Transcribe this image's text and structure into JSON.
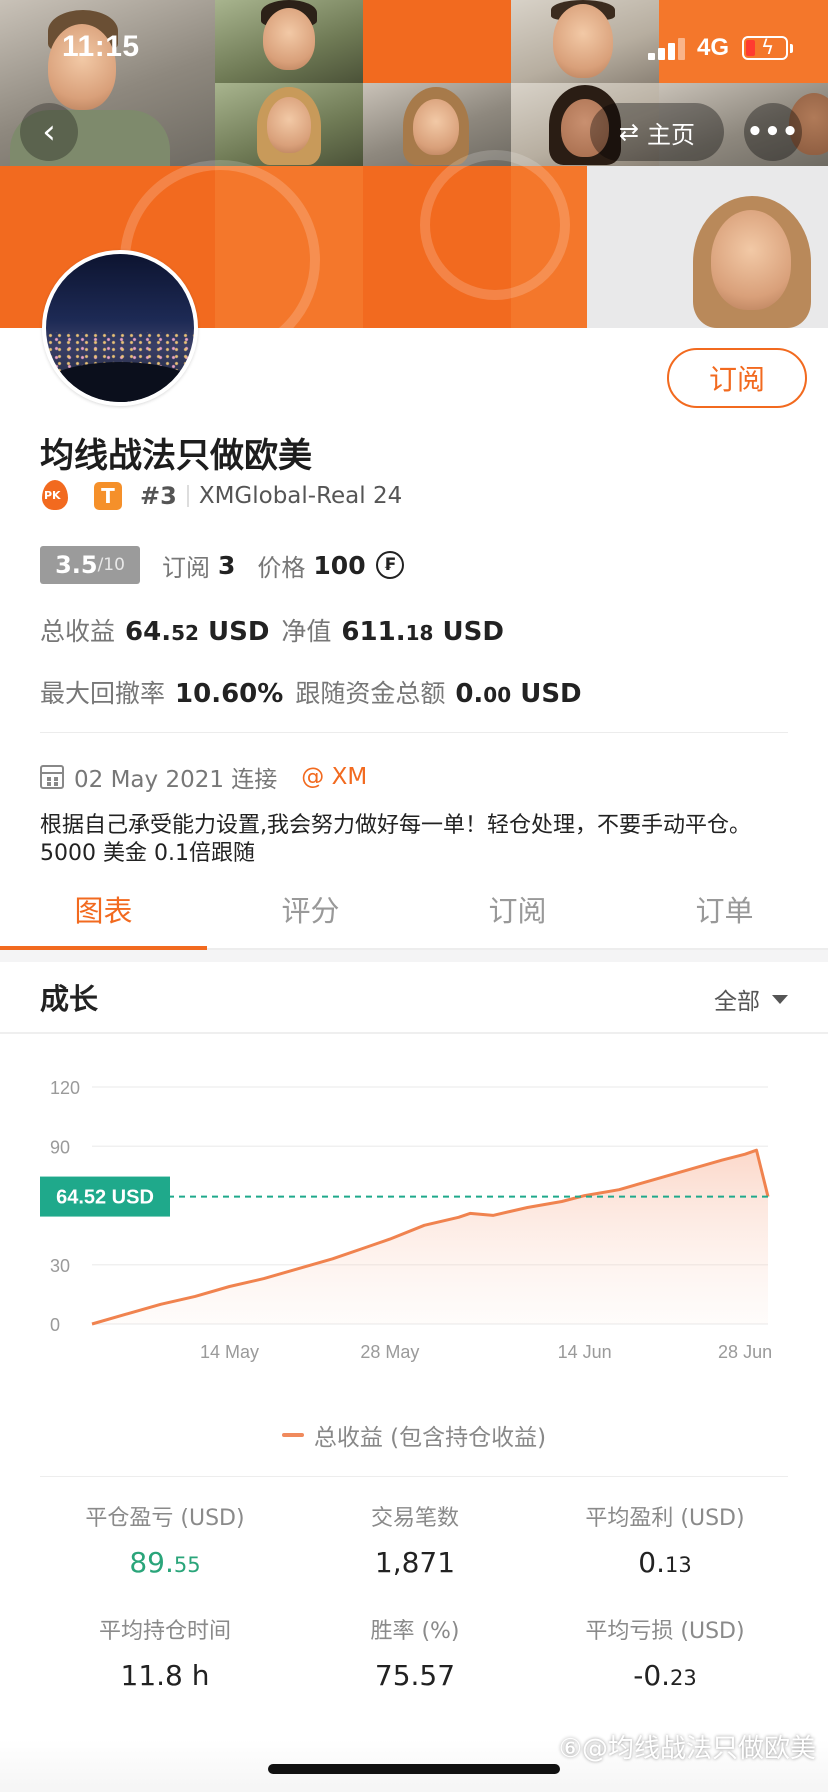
{
  "status_bar": {
    "time": "11:15",
    "network": "4G"
  },
  "nav": {
    "home_label": "主页",
    "more_label": "•••"
  },
  "profile": {
    "name": "均线战法只做欧美",
    "badge_pk": "PK",
    "badge_t": "T",
    "rank": "#3",
    "server": "XMGlobal-Real 24",
    "subscribe_label": "订阅",
    "score": "3.5",
    "score_scale": "/10",
    "subscriptions_label": "订阅",
    "subscriptions": "3",
    "price_label": "价格",
    "price": "100",
    "price_icon": "₣"
  },
  "stats_top": {
    "total_profit_label": "总收益",
    "total_profit_int": "64.",
    "total_profit_dec": "52",
    "total_profit_unit": "USD",
    "net_value_label": "净值",
    "net_value_int": "611.",
    "net_value_dec": "18",
    "net_value_unit": "USD",
    "max_drawdown_label": "最大回撤率",
    "max_drawdown": "10.60%",
    "follow_funds_label": "跟随资金总额",
    "follow_funds_int": "0.",
    "follow_funds_dec": "00",
    "follow_funds_unit": "USD"
  },
  "meta": {
    "connected": "02 May 2021 连接",
    "broker": "@ XM"
  },
  "description": "根据自己承受能力设置,我会努力做好每一单！轻仓处理，不要手动平仓。5000 美金 0.1倍跟随",
  "tabs": [
    "图表",
    "评分",
    "订阅",
    "订单"
  ],
  "growth": {
    "title": "成长",
    "filter": "全部"
  },
  "chart_data": {
    "type": "area",
    "yticks": [
      "120",
      "90",
      "64.52 USD",
      "30",
      "0"
    ],
    "ylim": [
      0,
      120
    ],
    "xticks": [
      "14 May",
      "28 May",
      "14 Jun",
      "28 Jun"
    ],
    "current_label": "64.52 USD",
    "current_value": 64.52,
    "legend": "总收益 (包含持仓收益)",
    "series": [
      {
        "name": "总收益 (包含持仓收益)",
        "x": [
          "2 May",
          "5 May",
          "8 May",
          "11 May",
          "14 May",
          "17 May",
          "20 May",
          "23 May",
          "26 May",
          "28 May",
          "31 May",
          "3 Jun",
          "4 Jun",
          "6 Jun",
          "9 Jun",
          "12 Jun",
          "14 Jun",
          "17 Jun",
          "20 Jun",
          "23 Jun",
          "26 Jun",
          "28 Jun",
          "29 Jun",
          "30 Jun"
        ],
        "values": [
          0,
          5,
          10,
          14,
          19,
          23,
          28,
          33,
          39,
          43,
          50,
          54,
          56,
          55,
          59,
          62,
          65,
          68,
          73,
          78,
          83,
          86,
          88,
          64.52
        ]
      }
    ]
  },
  "stats_grid": [
    {
      "label": "平仓盈亏 (USD)",
      "int": "89.",
      "dec": "55",
      "green": true
    },
    {
      "label": "交易笔数",
      "int": "1,871",
      "dec": "",
      "green": false
    },
    {
      "label": "平均盈利 (USD)",
      "int": "0.",
      "dec": "13",
      "green": false
    },
    {
      "label": "平均持仓时间",
      "int": "11.8 h",
      "dec": "",
      "green": false
    },
    {
      "label": "胜率 (%)",
      "int": "75.57",
      "dec": "",
      "green": false
    },
    {
      "label": "平均亏损 (USD)",
      "int": "-0.",
      "dec": "23",
      "green": false
    }
  ],
  "watermark": "⑥@均线战法只做欧美"
}
